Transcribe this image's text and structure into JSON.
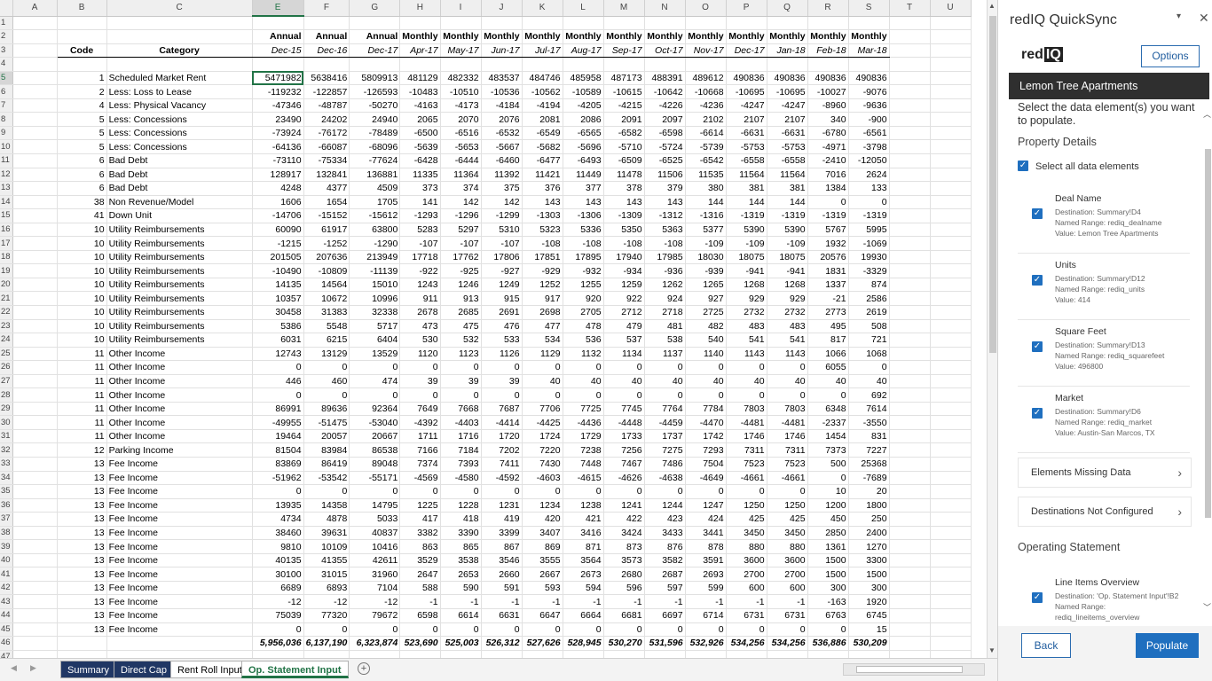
{
  "columns": [
    "A",
    "B",
    "C",
    "E",
    "F",
    "G",
    "H",
    "I",
    "J",
    "K",
    "L",
    "M",
    "N",
    "O",
    "P",
    "Q",
    "R",
    "S",
    "T",
    "U"
  ],
  "selected_column": "E",
  "header_row2": [
    "Annual",
    "Annual",
    "Annual",
    "Monthly",
    "Monthly",
    "Monthly",
    "Monthly",
    "Monthly",
    "Monthly",
    "Monthly",
    "Monthly",
    "Monthly",
    "Monthly",
    "Monthly",
    "Monthly"
  ],
  "header_row3": {
    "code": "Code",
    "category": "Category",
    "periods": [
      "Dec-15",
      "Dec-16",
      "Dec-17",
      "Apr-17",
      "May-17",
      "Jun-17",
      "Jul-17",
      "Aug-17",
      "Sep-17",
      "Oct-17",
      "Nov-17",
      "Dec-17",
      "Jan-18",
      "Feb-18",
      "Mar-18"
    ]
  },
  "rows": [
    {
      "row": 5,
      "code": "1",
      "category": "Scheduled Market Rent",
      "vals": [
        "5471982",
        "5638416",
        "5809913",
        "481129",
        "482332",
        "483537",
        "484746",
        "485958",
        "487173",
        "488391",
        "489612",
        "490836",
        "490836",
        "490836",
        "490836"
      ]
    },
    {
      "row": 6,
      "code": "2",
      "category": "Less: Loss to Lease",
      "vals": [
        "-119232",
        "-122857",
        "-126593",
        "-10483",
        "-10510",
        "-10536",
        "-10562",
        "-10589",
        "-10615",
        "-10642",
        "-10668",
        "-10695",
        "-10695",
        "-10027",
        "-9076"
      ]
    },
    {
      "row": 7,
      "code": "4",
      "category": "Less: Physical Vacancy",
      "vals": [
        "-47346",
        "-48787",
        "-50270",
        "-4163",
        "-4173",
        "-4184",
        "-4194",
        "-4205",
        "-4215",
        "-4226",
        "-4236",
        "-4247",
        "-4247",
        "-8960",
        "-9636"
      ]
    },
    {
      "row": 8,
      "code": "5",
      "category": "Less: Concessions",
      "vals": [
        "23490",
        "24202",
        "24940",
        "2065",
        "2070",
        "2076",
        "2081",
        "2086",
        "2091",
        "2097",
        "2102",
        "2107",
        "2107",
        "340",
        "-900"
      ]
    },
    {
      "row": 9,
      "code": "5",
      "category": "Less: Concessions",
      "vals": [
        "-73924",
        "-76172",
        "-78489",
        "-6500",
        "-6516",
        "-6532",
        "-6549",
        "-6565",
        "-6582",
        "-6598",
        "-6614",
        "-6631",
        "-6631",
        "-6780",
        "-6561"
      ]
    },
    {
      "row": 10,
      "code": "5",
      "category": "Less: Concessions",
      "vals": [
        "-64136",
        "-66087",
        "-68096",
        "-5639",
        "-5653",
        "-5667",
        "-5682",
        "-5696",
        "-5710",
        "-5724",
        "-5739",
        "-5753",
        "-5753",
        "-4971",
        "-3798"
      ]
    },
    {
      "row": 11,
      "code": "6",
      "category": "Bad Debt",
      "vals": [
        "-73110",
        "-75334",
        "-77624",
        "-6428",
        "-6444",
        "-6460",
        "-6477",
        "-6493",
        "-6509",
        "-6525",
        "-6542",
        "-6558",
        "-6558",
        "-2410",
        "-12050"
      ]
    },
    {
      "row": 12,
      "code": "6",
      "category": "Bad Debt",
      "vals": [
        "128917",
        "132841",
        "136881",
        "11335",
        "11364",
        "11392",
        "11421",
        "11449",
        "11478",
        "11506",
        "11535",
        "11564",
        "11564",
        "7016",
        "2624"
      ]
    },
    {
      "row": 13,
      "code": "6",
      "category": "Bad Debt",
      "vals": [
        "4248",
        "4377",
        "4509",
        "373",
        "374",
        "375",
        "376",
        "377",
        "378",
        "379",
        "380",
        "381",
        "381",
        "1384",
        "133"
      ]
    },
    {
      "row": 14,
      "code": "38",
      "category": "Non Revenue/Model",
      "vals": [
        "1606",
        "1654",
        "1705",
        "141",
        "142",
        "142",
        "143",
        "143",
        "143",
        "143",
        "144",
        "144",
        "144",
        "0",
        "0"
      ]
    },
    {
      "row": 15,
      "code": "41",
      "category": "Down Unit",
      "vals": [
        "-14706",
        "-15152",
        "-15612",
        "-1293",
        "-1296",
        "-1299",
        "-1303",
        "-1306",
        "-1309",
        "-1312",
        "-1316",
        "-1319",
        "-1319",
        "-1319",
        "-1319"
      ]
    },
    {
      "row": 16,
      "code": "10",
      "category": "Utility Reimbursements",
      "vals": [
        "60090",
        "61917",
        "63800",
        "5283",
        "5297",
        "5310",
        "5323",
        "5336",
        "5350",
        "5363",
        "5377",
        "5390",
        "5390",
        "5767",
        "5995"
      ]
    },
    {
      "row": 17,
      "code": "10",
      "category": "Utility Reimbursements",
      "vals": [
        "-1215",
        "-1252",
        "-1290",
        "-107",
        "-107",
        "-107",
        "-108",
        "-108",
        "-108",
        "-108",
        "-109",
        "-109",
        "-109",
        "1932",
        "-1069"
      ]
    },
    {
      "row": 18,
      "code": "10",
      "category": "Utility Reimbursements",
      "vals": [
        "201505",
        "207636",
        "213949",
        "17718",
        "17762",
        "17806",
        "17851",
        "17895",
        "17940",
        "17985",
        "18030",
        "18075",
        "18075",
        "20576",
        "19930"
      ]
    },
    {
      "row": 19,
      "code": "10",
      "category": "Utility Reimbursements",
      "vals": [
        "-10490",
        "-10809",
        "-11139",
        "-922",
        "-925",
        "-927",
        "-929",
        "-932",
        "-934",
        "-936",
        "-939",
        "-941",
        "-941",
        "1831",
        "-3329"
      ]
    },
    {
      "row": 20,
      "code": "10",
      "category": "Utility Reimbursements",
      "vals": [
        "14135",
        "14564",
        "15010",
        "1243",
        "1246",
        "1249",
        "1252",
        "1255",
        "1259",
        "1262",
        "1265",
        "1268",
        "1268",
        "1337",
        "874"
      ]
    },
    {
      "row": 21,
      "code": "10",
      "category": "Utility Reimbursements",
      "vals": [
        "10357",
        "10672",
        "10996",
        "911",
        "913",
        "915",
        "917",
        "920",
        "922",
        "924",
        "927",
        "929",
        "929",
        "-21",
        "2586"
      ]
    },
    {
      "row": 22,
      "code": "10",
      "category": "Utility Reimbursements",
      "vals": [
        "30458",
        "31383",
        "32338",
        "2678",
        "2685",
        "2691",
        "2698",
        "2705",
        "2712",
        "2718",
        "2725",
        "2732",
        "2732",
        "2773",
        "2619"
      ]
    },
    {
      "row": 23,
      "code": "10",
      "category": "Utility Reimbursements",
      "vals": [
        "5386",
        "5548",
        "5717",
        "473",
        "475",
        "476",
        "477",
        "478",
        "479",
        "481",
        "482",
        "483",
        "483",
        "495",
        "508"
      ]
    },
    {
      "row": 24,
      "code": "10",
      "category": "Utility Reimbursements",
      "vals": [
        "6031",
        "6215",
        "6404",
        "530",
        "532",
        "533",
        "534",
        "536",
        "537",
        "538",
        "540",
        "541",
        "541",
        "817",
        "721"
      ]
    },
    {
      "row": 25,
      "code": "11",
      "category": "Other Income",
      "vals": [
        "12743",
        "13129",
        "13529",
        "1120",
        "1123",
        "1126",
        "1129",
        "1132",
        "1134",
        "1137",
        "1140",
        "1143",
        "1143",
        "1066",
        "1068"
      ]
    },
    {
      "row": 26,
      "code": "11",
      "category": "Other Income",
      "vals": [
        "0",
        "0",
        "0",
        "0",
        "0",
        "0",
        "0",
        "0",
        "0",
        "0",
        "0",
        "0",
        "0",
        "6055",
        "0"
      ]
    },
    {
      "row": 27,
      "code": "11",
      "category": "Other Income",
      "vals": [
        "446",
        "460",
        "474",
        "39",
        "39",
        "39",
        "40",
        "40",
        "40",
        "40",
        "40",
        "40",
        "40",
        "40",
        "40"
      ]
    },
    {
      "row": 28,
      "code": "11",
      "category": "Other Income",
      "vals": [
        "0",
        "0",
        "0",
        "0",
        "0",
        "0",
        "0",
        "0",
        "0",
        "0",
        "0",
        "0",
        "0",
        "0",
        "692"
      ]
    },
    {
      "row": 29,
      "code": "11",
      "category": "Other Income",
      "vals": [
        "86991",
        "89636",
        "92364",
        "7649",
        "7668",
        "7687",
        "7706",
        "7725",
        "7745",
        "7764",
        "7784",
        "7803",
        "7803",
        "6348",
        "7614"
      ]
    },
    {
      "row": 30,
      "code": "11",
      "category": "Other Income",
      "vals": [
        "-49955",
        "-51475",
        "-53040",
        "-4392",
        "-4403",
        "-4414",
        "-4425",
        "-4436",
        "-4448",
        "-4459",
        "-4470",
        "-4481",
        "-4481",
        "-2337",
        "-3550"
      ]
    },
    {
      "row": 31,
      "code": "11",
      "category": "Other Income",
      "vals": [
        "19464",
        "20057",
        "20667",
        "1711",
        "1716",
        "1720",
        "1724",
        "1729",
        "1733",
        "1737",
        "1742",
        "1746",
        "1746",
        "1454",
        "831"
      ]
    },
    {
      "row": 32,
      "code": "12",
      "category": "Parking Income",
      "vals": [
        "81504",
        "83984",
        "86538",
        "7166",
        "7184",
        "7202",
        "7220",
        "7238",
        "7256",
        "7275",
        "7293",
        "7311",
        "7311",
        "7373",
        "7227"
      ]
    },
    {
      "row": 33,
      "code": "13",
      "category": "Fee Income",
      "vals": [
        "83869",
        "86419",
        "89048",
        "7374",
        "7393",
        "7411",
        "7430",
        "7448",
        "7467",
        "7486",
        "7504",
        "7523",
        "7523",
        "500",
        "25368"
      ]
    },
    {
      "row": 34,
      "code": "13",
      "category": "Fee Income",
      "vals": [
        "-51962",
        "-53542",
        "-55171",
        "-4569",
        "-4580",
        "-4592",
        "-4603",
        "-4615",
        "-4626",
        "-4638",
        "-4649",
        "-4661",
        "-4661",
        "0",
        "-7689"
      ]
    },
    {
      "row": 35,
      "code": "13",
      "category": "Fee Income",
      "vals": [
        "0",
        "0",
        "0",
        "0",
        "0",
        "0",
        "0",
        "0",
        "0",
        "0",
        "0",
        "0",
        "0",
        "10",
        "20"
      ]
    },
    {
      "row": 36,
      "code": "13",
      "category": "Fee Income",
      "vals": [
        "13935",
        "14358",
        "14795",
        "1225",
        "1228",
        "1231",
        "1234",
        "1238",
        "1241",
        "1244",
        "1247",
        "1250",
        "1250",
        "1200",
        "1800"
      ]
    },
    {
      "row": 37,
      "code": "13",
      "category": "Fee Income",
      "vals": [
        "4734",
        "4878",
        "5033",
        "417",
        "418",
        "419",
        "420",
        "421",
        "422",
        "423",
        "424",
        "425",
        "425",
        "450",
        "250"
      ]
    },
    {
      "row": 38,
      "code": "13",
      "category": "Fee Income",
      "vals": [
        "38460",
        "39631",
        "40837",
        "3382",
        "3390",
        "3399",
        "3407",
        "3416",
        "3424",
        "3433",
        "3441",
        "3450",
        "3450",
        "2850",
        "2400"
      ]
    },
    {
      "row": 39,
      "code": "13",
      "category": "Fee Income",
      "vals": [
        "9810",
        "10109",
        "10416",
        "863",
        "865",
        "867",
        "869",
        "871",
        "873",
        "876",
        "878",
        "880",
        "880",
        "1361",
        "1270"
      ]
    },
    {
      "row": 40,
      "code": "13",
      "category": "Fee Income",
      "vals": [
        "40135",
        "41355",
        "42611",
        "3529",
        "3538",
        "3546",
        "3555",
        "3564",
        "3573",
        "3582",
        "3591",
        "3600",
        "3600",
        "1500",
        "3300"
      ]
    },
    {
      "row": 41,
      "code": "13",
      "category": "Fee Income",
      "vals": [
        "30100",
        "31015",
        "31960",
        "2647",
        "2653",
        "2660",
        "2667",
        "2673",
        "2680",
        "2687",
        "2693",
        "2700",
        "2700",
        "1500",
        "1500"
      ]
    },
    {
      "row": 42,
      "code": "13",
      "category": "Fee Income",
      "vals": [
        "6689",
        "6893",
        "7104",
        "588",
        "590",
        "591",
        "593",
        "594",
        "596",
        "597",
        "599",
        "600",
        "600",
        "300",
        "300"
      ]
    },
    {
      "row": 43,
      "code": "13",
      "category": "Fee Income",
      "vals": [
        "-12",
        "-12",
        "-12",
        "-1",
        "-1",
        "-1",
        "-1",
        "-1",
        "-1",
        "-1",
        "-1",
        "-1",
        "-1",
        "-163",
        "1920"
      ]
    },
    {
      "row": 44,
      "code": "13",
      "category": "Fee Income",
      "vals": [
        "75039",
        "77320",
        "79672",
        "6598",
        "6614",
        "6631",
        "6647",
        "6664",
        "6681",
        "6697",
        "6714",
        "6731",
        "6731",
        "6763",
        "6745"
      ]
    },
    {
      "row": 45,
      "code": "13",
      "category": "Fee Income",
      "vals": [
        "0",
        "0",
        "0",
        "0",
        "0",
        "0",
        "0",
        "0",
        "0",
        "0",
        "0",
        "0",
        "0",
        "0",
        "15"
      ]
    }
  ],
  "totals": [
    "5,956,036",
    "6,137,190",
    "6,323,874",
    "523,690",
    "525,003",
    "526,312",
    "527,626",
    "528,945",
    "530,270",
    "531,596",
    "532,926",
    "534,256",
    "534,256",
    "536,886",
    "530,209"
  ],
  "sheet_tabs": [
    {
      "label": "Summary",
      "style": "blue"
    },
    {
      "label": "Direct Cap",
      "style": "blue"
    },
    {
      "label": "Rent Roll Input",
      "style": "plain"
    },
    {
      "label": "Op. Statement Input",
      "style": "active"
    }
  ],
  "add_sheet_icon": "+",
  "panel": {
    "title": "redIQ QuickSync",
    "menu_icon": "▾",
    "close_icon": "✕",
    "logo": {
      "prefix": "red",
      "suffix": "IQ"
    },
    "options_label": "Options",
    "property_name": "Lemon Tree Apartments",
    "intro": "Select the data element(s) you want to populate.",
    "property_details_heading": "Property Details",
    "select_all_label": "Select all data elements",
    "property_cards": [
      {
        "title": "Deal Name",
        "lines": [
          "Destination: Summary!D4",
          "Named Range: rediq_dealname",
          "Value: Lemon Tree Apartments"
        ]
      },
      {
        "title": "Units",
        "lines": [
          "Destination: Summary!D12",
          "Named Range: rediq_units",
          "Value: 414"
        ]
      },
      {
        "title": "Square Feet",
        "lines": [
          "Destination: Summary!D13",
          "Named Range: rediq_squarefeet",
          "Value: 496800"
        ]
      },
      {
        "title": "Market",
        "lines": [
          "Destination: Summary!D6",
          "Named Range: rediq_market",
          "Value: Austin-San Marcos, TX"
        ]
      }
    ],
    "elements_missing_label": "Elements Missing Data",
    "destinations_not_configured_label": "Destinations Not Configured",
    "operating_statement_heading": "Operating Statement",
    "os_card": {
      "title": "Line Items Overview",
      "lines": [
        "Destination: 'Op. Statement Input'!B2",
        "Named Range:",
        "rediq_lineitems_overview"
      ]
    },
    "back_label": "Back",
    "populate_label": "Populate"
  }
}
